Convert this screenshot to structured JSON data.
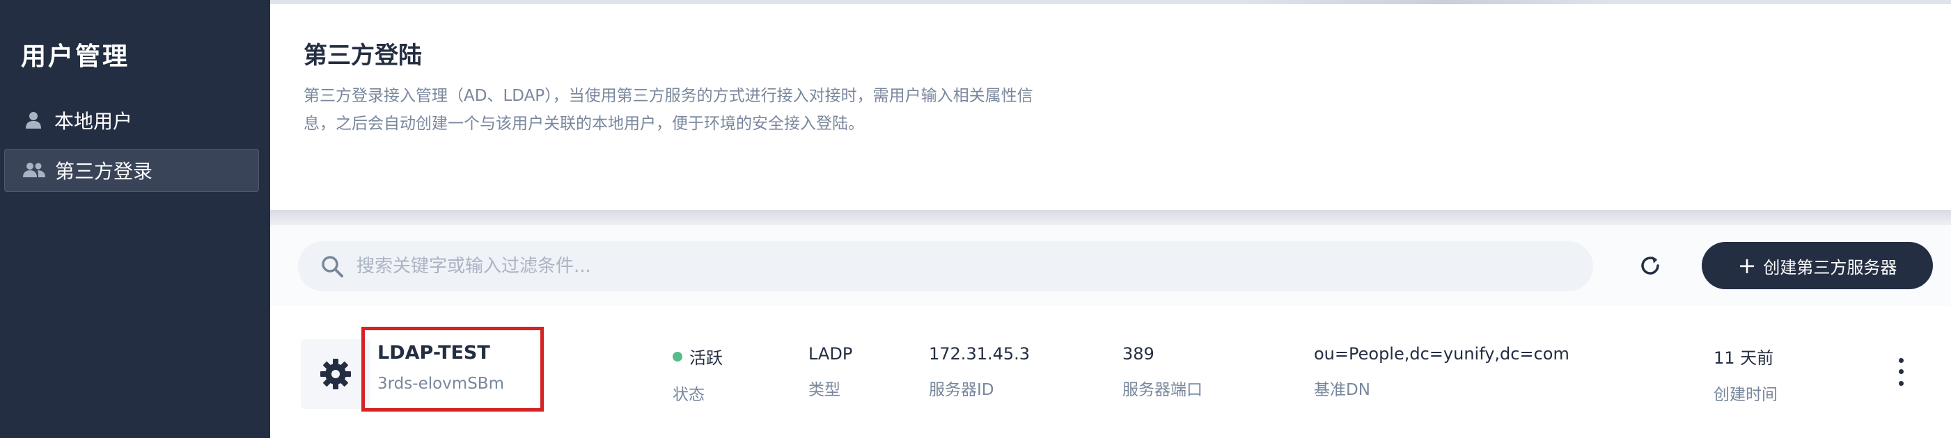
{
  "sidebar": {
    "title": "用户管理",
    "items": [
      {
        "label": "本地用户",
        "icon": "user-icon",
        "active": false
      },
      {
        "label": "第三方登录",
        "icon": "users-icon",
        "active": true
      }
    ]
  },
  "header": {
    "title": "第三方登陆",
    "description_line1": "第三方登录接入管理（AD、LDAP），当使用第三方服务的方式进行接入对接时，需用户输入相关属性信",
    "description_line2": "息，之后会自动创建一个与该用户关联的本地用户，便于环境的安全接入登陆。"
  },
  "toolbar": {
    "search_placeholder": "搜索关键字或输入过滤条件...",
    "search_value": "",
    "refresh_icon": "refresh-icon",
    "create_label": "创建第三方服务器",
    "create_icon": "plus-icon"
  },
  "servers": [
    {
      "icon": "gear-icon",
      "name": "LDAP-TEST",
      "id": "3rds-elovmSBm",
      "status": "活跃",
      "status_label": "状态",
      "status_color": "#55bc8a",
      "type": "LADP",
      "type_label": "类型",
      "server_id": "172.31.45.3",
      "server_id_label": "服务器ID",
      "port": "389",
      "port_label": "服务器端口",
      "base_dn": "ou=People,dc=yunify,dc=com",
      "base_dn_label": "基准DN",
      "created": "11 天前",
      "created_label": "创建时间",
      "more_icon": "more-vertical-icon"
    }
  ],
  "colors": {
    "sidebar_bg": "#242e42",
    "accent": "#242e42",
    "highlight": "#d52224",
    "status_active": "#55bc8a"
  }
}
